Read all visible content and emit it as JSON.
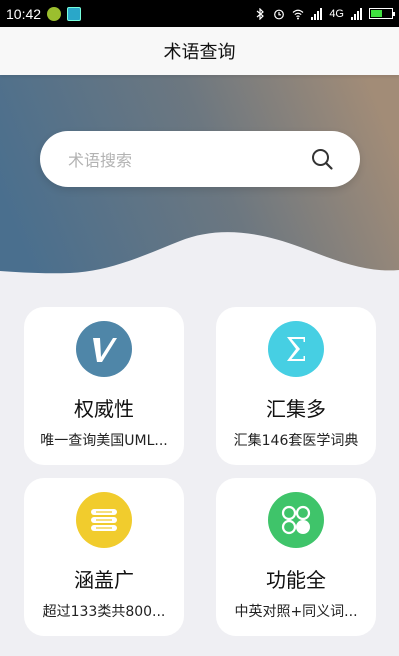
{
  "status_bar": {
    "time": "10:42",
    "network": "4G",
    "colors": {
      "battery": "#40e040"
    }
  },
  "app_bar": {
    "title": "术语查询"
  },
  "search": {
    "placeholder": "术语搜索"
  },
  "features": [
    {
      "title": "权威性",
      "desc": "唯一查询美国UML...",
      "icon": "v-logo-icon",
      "color": "#4f86a8"
    },
    {
      "title": "汇集多",
      "desc": "汇集146套医学词典",
      "icon": "sigma-icon",
      "color": "#46cfe3"
    },
    {
      "title": "涵盖广",
      "desc": "超过133类共800...",
      "icon": "stack-icon",
      "color": "#f1cc2d"
    },
    {
      "title": "功能全",
      "desc": "中英对照+同义词...",
      "icon": "four-dots-icon",
      "color": "#3fc46a"
    }
  ],
  "colors": {
    "hero_left": "#4d6f8c",
    "hero_right": "#a08d78",
    "background": "#efeff3"
  }
}
